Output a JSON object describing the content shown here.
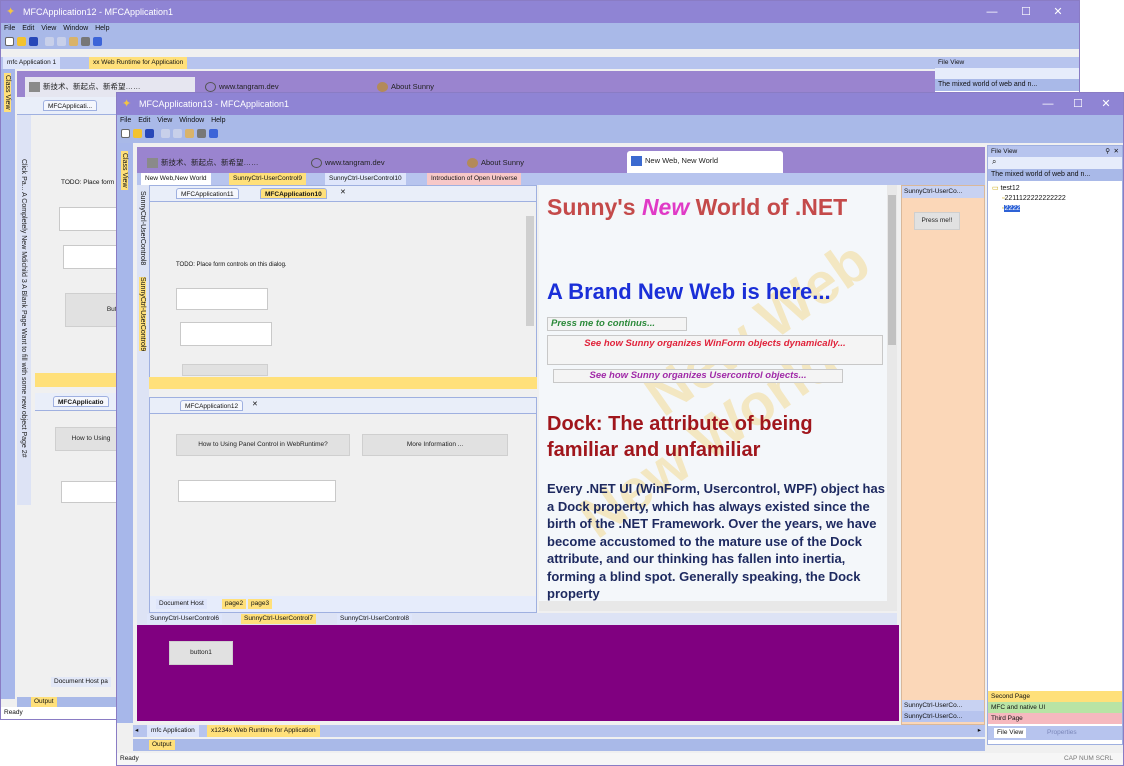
{
  "back_window": {
    "title": "MFCApplication12 - MFCApplication1",
    "menu": [
      "File",
      "Edit",
      "View",
      "Window",
      "Help"
    ],
    "mdi_tabs": [
      "mfc Application 1",
      "xx Web Runtime for Application"
    ],
    "left_strip_label": "Class View",
    "doc_tabs": [
      "新技术、新起点、新希望……",
      "www.tangram.dev",
      "About Sunny"
    ],
    "right_panel": {
      "header": "File View",
      "text": "The mixed world of web and n..."
    },
    "pane_tab": "MFCApplicati...",
    "todo": "TODO: Place form",
    "button_label": "Butto",
    "vertical_tabs": "Click Pa...  A Completely New Mdichild 3  A Blank Page Want to fill with some new object  Page 2#",
    "pane2_tab": "MFCApplicatio",
    "how_button": "How to Using",
    "bottom_tab": "Document Host  pa",
    "output_tab": "Output",
    "status": "Ready"
  },
  "front_window": {
    "title": "MFCApplication13 - MFCApplication1",
    "menu": [
      "File",
      "Edit",
      "View",
      "Window",
      "Help"
    ],
    "left_strip_label": "Class View",
    "doc_tabs": [
      "新技术、新起点、新希望……",
      "www.tangram.dev",
      "About Sunny",
      "New Web, New World"
    ],
    "sub_tabs": [
      "New Web,New World",
      "SunnyCtrl-UserControl9",
      "SunnyCtrl-UserControl10",
      "Introduction of Open Universe"
    ],
    "vertical_tabs": [
      "SunnyCtrl-UserControl8",
      "SunnyCtrl-UserControl9"
    ],
    "pane1": {
      "tabs": [
        "MFCApplication11",
        "MFCApplication10"
      ],
      "todo": "TODO: Place form controls on this dialog."
    },
    "pane2": {
      "tab": "MFCApplication12",
      "how_button": "How to Using Panel Control in WebRuntime?",
      "more_button": "More Information ..."
    },
    "pane_bottom_tabs": [
      "Document Host",
      "page2",
      "page3"
    ],
    "web": {
      "heading_pre": "Sunny's ",
      "heading_em": "New",
      "heading_post": " World of .NET",
      "subheading": "A Brand New Web is here...",
      "watermark1": "New Web",
      "watermark2": "New World",
      "btn1": "Press me to continus...",
      "btn2": "See how Sunny organizes WinForm objects dynamically...",
      "btn3": "See how Sunny organizes Usercontrol objects...",
      "dock_heading": "Dock: The attribute of being familiar and unfamiliar",
      "paragraph": "Every .NET UI (WinForm, Usercontrol, WPF) object has a Dock property, which has always existed since the birth of the .NET Framework. Over the years, we have become accustomed to the mature use of the Dock attribute, and our thinking has fallen into inertia, forming a blind spot. Generally speaking, the Dock property"
    },
    "peach_panel": {
      "header": "SunnyCtrl-UserCo...",
      "button": "Press me!!",
      "footer1": "SunnyCtrl-UserCo...",
      "footer2": "SunnyCtrl-UserCo..."
    },
    "bottom_tabs": [
      "SunnyCtrl-UserControl6",
      "SunnyCtrl-UserControl7",
      "SunnyCtrl-UserControl8"
    ],
    "purple_button": "button1",
    "file_view": {
      "header": "File View",
      "text": "The mixed world of web and n...",
      "tree": [
        "test12",
        "2211122222222222",
        "2222"
      ],
      "sections": [
        "Second Page",
        "MFC and native UI",
        "Third Page"
      ],
      "tabs": [
        "File View",
        "Properties"
      ]
    },
    "mdi_tabs": [
      "mfc Application",
      "x1234x Web Runtime for Application"
    ],
    "output_tab": "Output",
    "status": "Ready",
    "status_right": "CAP NUM SCRL"
  },
  "colors": {
    "title": "#8f84d4",
    "menu": "#a9b9e8",
    "purple_area": "#800080",
    "peach": "#fbd7b8"
  }
}
